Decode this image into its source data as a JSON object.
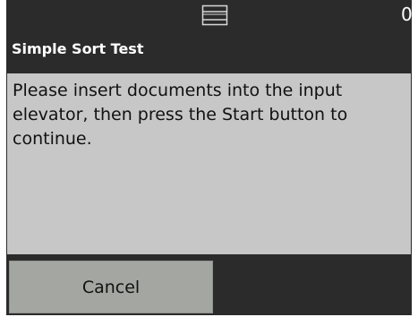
{
  "status_bar": {
    "tray_icon": "output-tray-icon",
    "counter": "0"
  },
  "dialog": {
    "title": "Simple Sort Test",
    "message": "Please insert documents into the input elevator, then press the Start button to continue."
  },
  "footer": {
    "cancel_label": "Cancel"
  },
  "colors": {
    "background": "#2b2b2b",
    "panel": "#c7c7c7",
    "button": "#a4a6a2",
    "title_text": "#ffffff",
    "body_text": "#111111"
  }
}
